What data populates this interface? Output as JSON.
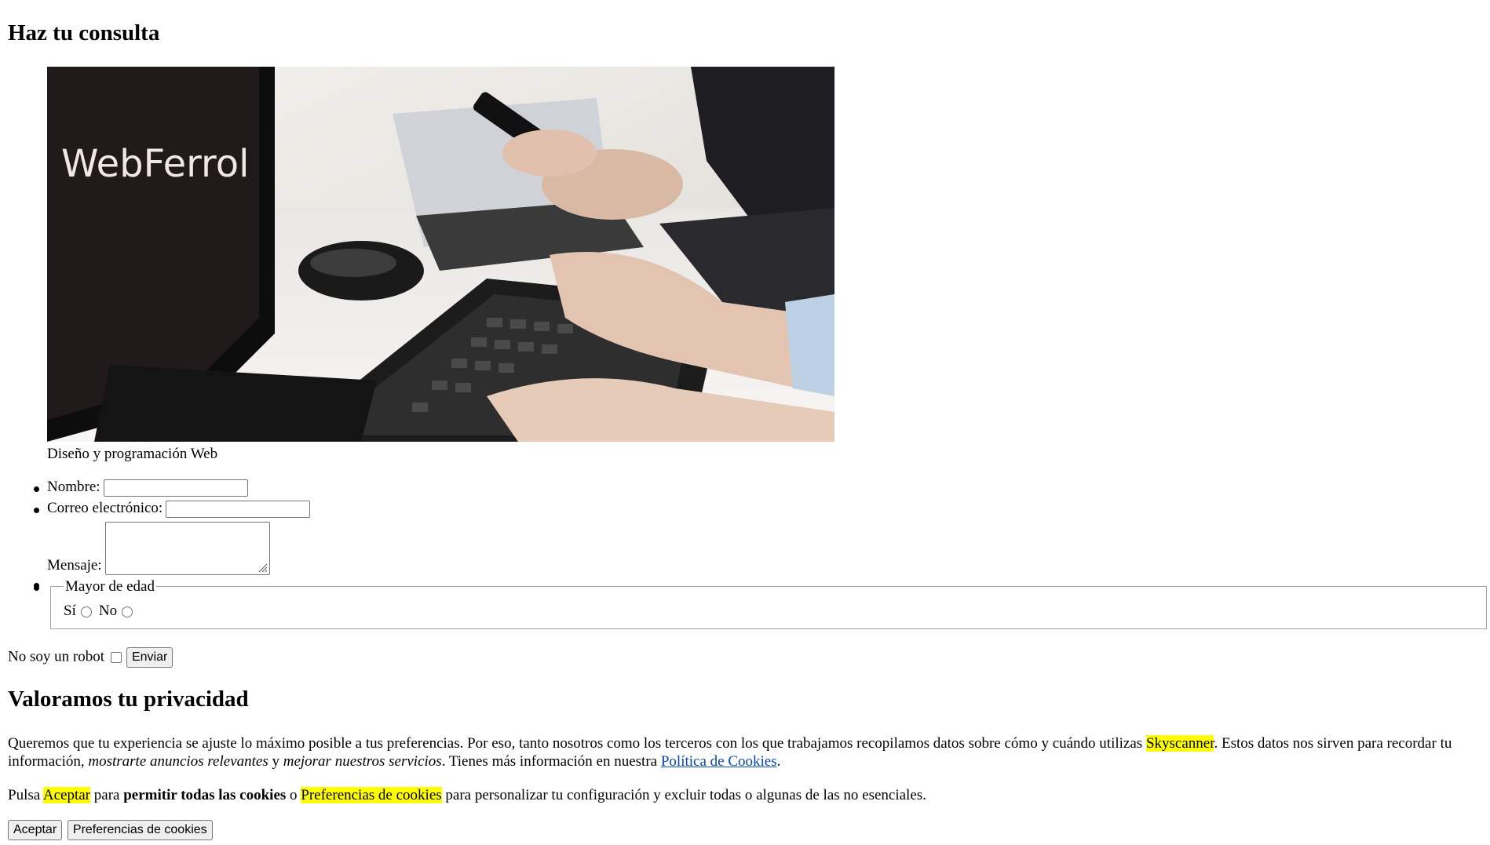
{
  "consulta": {
    "heading": "Haz tu consulta",
    "image_logo_text": "WebFerrol",
    "caption": "Diseño y programación Web"
  },
  "form": {
    "nombre_label": "Nombre:",
    "nombre_value": "",
    "correo_label": "Correo electrónico:",
    "correo_value": "",
    "mensaje_label": "Mensaje:",
    "mensaje_value": "",
    "edad_legend": "Mayor de edad",
    "radio_si_label": "Sí",
    "radio_no_label": "No",
    "robot_label": "No soy un robot",
    "submit_label": "Enviar"
  },
  "privacy": {
    "heading": "Valoramos tu privacidad",
    "p1_a": "Queremos que tu experiencia se ajuste lo máximo posible a tus preferencias. Por eso, tanto nosotros como los terceros con los que trabajamos recopilamos datos sobre cómo y cuándo utilizas ",
    "p1_brand": "Skyscanner",
    "p1_b": ". Estos datos nos sirven para recordar tu información, ",
    "p1_em1": "mostrarte anuncios relevantes",
    "p1_c": " y ",
    "p1_em2": "mejorar nuestros servicios",
    "p1_d": ". Tienes más información en nuestra ",
    "p1_link": "Política de Cookies",
    "p1_e": ".",
    "p2_a": "Pulsa ",
    "p2_accept": "Aceptar",
    "p2_b": " para ",
    "p2_strong": "permitir todas las cookies",
    "p2_c": " o ",
    "p2_prefs": "Preferencias de cookies",
    "p2_d": " para personalizar tu configuración y excluir todas o algunas de las no esenciales.",
    "accept_button": "Aceptar",
    "prefs_button": "Preferencias de cookies"
  },
  "colors": {
    "highlight": "#ffff00",
    "link": "#0645ad"
  }
}
